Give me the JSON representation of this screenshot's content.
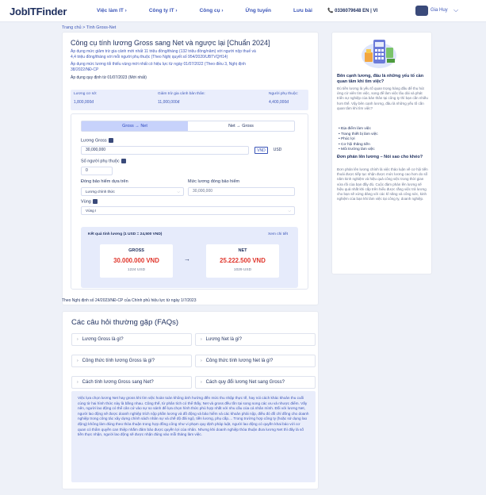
{
  "header": {
    "logo": "JobITFinder",
    "nav": [
      "Việc làm IT ›",
      "Công ty IT ›",
      "Công cụ ›",
      "Ứng tuyển",
      "Lưu bài"
    ],
    "phone": "📞 0336079648  EN | VI",
    "user_name": "Gia Huy",
    "chevron": "⌵"
  },
  "breadcrumb": "Trang chủ  >  Tính Gross-Net",
  "main": {
    "title": "Công cụ tính lương Gross sang Net và ngược lại [Chuẩn 2024]",
    "note_1a": "Áp dụng mức giảm trừ gia cảnh mới nhất 11 triệu đồng/tháng (132 triệu đồng/năm) với người nộp thuế và",
    "note_1b": "4,4 triệu đồng/tháng với mỗi người phụ thuộc (Theo Nghị quyết số 954/2020/UBTVQH14)",
    "note_2a": "Áp dụng mức lương tối thiểu vùng mới nhất có hiệu lực từ ngày 01/07/2022 (Theo điều 3, Nghị định",
    "note_2b": "38/2022/NĐ-CP",
    "note_3": "Áp dụng quy định từ 01/07/2023 (Mới nhất)",
    "info": {
      "l1": "Lương cơ sở:",
      "v1": "1,800,000đ",
      "l2": "Giảm trừ gia cảnh bản thân:",
      "v2": "11,000,000đ",
      "l3": "Người phụ thuộc:",
      "v3": "4,400,000đ"
    }
  },
  "calculator": {
    "tab_gross_to_net": "Gross → Net",
    "tab_net_to_gross": "Net → Gross",
    "gross_label": "Lương Gross",
    "gross_value": "30,000,000",
    "currency_vnd": "VND",
    "currency_usd": "USD",
    "dependents_label": "Số người phụ thuộc",
    "dependents_value": "0",
    "insurance_label": "Đóng bảo hiểm dựa trên",
    "insurance_value": "Lương chính thức",
    "insurance_salary_label": "Mức lương đóng bảo hiểm",
    "insurance_salary_value": "30,000,000",
    "region_label": "Vùng",
    "region_value": "Vùng I",
    "result_title": "Kết quả tính lương (1 USD = 24,500 VND)",
    "result_link": "Xem chi tiết",
    "gross_title": "GROSS",
    "gross_vnd": "30.000.000 VND",
    "gross_usd": "1224 USD",
    "arrow": "→",
    "net_title": "NET",
    "net_vnd": "25.222.500 VND",
    "net_usd": "1029 USD"
  },
  "decree_note": "Theo Nghị định số 24/2023/NĐ-CP của Chính phủ hiệu lực từ ngày 1/7/2023",
  "sidebar": {
    "h1": "Bên cạnh lương, đâu là những yếu tố cần quan tâm khi tìm việc?",
    "p1": "Đủ tiền lương là yếu tố quan trọng hàng đầu để thu hút ứng cử viên tìm việc, song để làm việc lâu dài và phát triển sự nghiệp của bản thân tại công ty thì bạn cần nhiều hơn thế. Vậy bên cạnh lương, đâu là những yếu tố cần quan tâm khi tìm việc?",
    "bullets": [
      "Địa điểm làm việc",
      "Trang thiết bị làm việc",
      "Phúc lợi",
      "Cơ hội thăng tiến",
      "Môi trường làm việc"
    ],
    "h2": "Đơn phản lên lương – Nói sao cho khéo?",
    "p2": "Đơn phản lên lương chính là việc thảo luận về cơ hội tiến thoái được tiếp tục nhận được mức lương cao hơn do số năm kinh nghiệm và hiệu quả công việc trong thời gian vừa rồi của bạn đầy đủ. Cuộc đàm phán lên lương sẽ hiệu quả nhất khi cấp trên hiểu được rằng việc trả lương cho bạn sẽ xứng đáng với các kĩ năng và công sức, kinh nghiệm của bạn khi làm việc tại công ty, doanh nghiệp."
  },
  "faq": {
    "title": "Các câu hỏi thường gặp (FAQs)",
    "questions": [
      "Lương Gross là gì?",
      "Lương Net là gì?",
      "Công thức tính lương Gross là gì?",
      "Công thức tính lương Net là gì?",
      "Cách tính lương Gross sang Net?",
      "Cách quy đổi lương Net sang Gross?"
    ],
    "chevron": "›",
    "body": "Việc lựa chọn lương Net hay gross khi tìm việc hoàn toàn không ảnh hưởng đến mức thu nhập thực tế, hay nói cách khác khoản thu cuối cùng từ hai hình thức này là bằng nhau. Cũng thế, từ phân tích có thể thấy, Net và gross đều tồn tại song song các ưu và nhược điểm. Vấy nên, người lao động có thể cân cứ vào sự so sánh để lựa chọn hình thức phù hợp nhất với nhu cầu của cá nhân mình. Đối với lương Net, người lao động sẽ được doanh nghiệp trích nộp phần lương và đồ động và bảo hiểm và các khoản phải nộp, điều đó đồ chỉ đồng cho doanh nghiệp trong công tác xây dựng chính sách nhân sự và chế độ đãi ngộ, tiền lương, phụ cấp.... Trong trường hợp công ty (hoặc sử dụng lao động) không làm đúng theo thỏa thuận trong hợp đồng công như vi phạm quy định pháp luật, người lao động có quyền khai báo với cơ quan có thẩm quyền can thiệp nhằm đảm bảo được quyền lợi của nhân. Nhưng khi doanh nghiệp thỏa thuận đưa lương Net thì đây là số tiền thực nhận, người lao động sẽ được nhận đúng vào mỗi tháng làm việc."
  }
}
